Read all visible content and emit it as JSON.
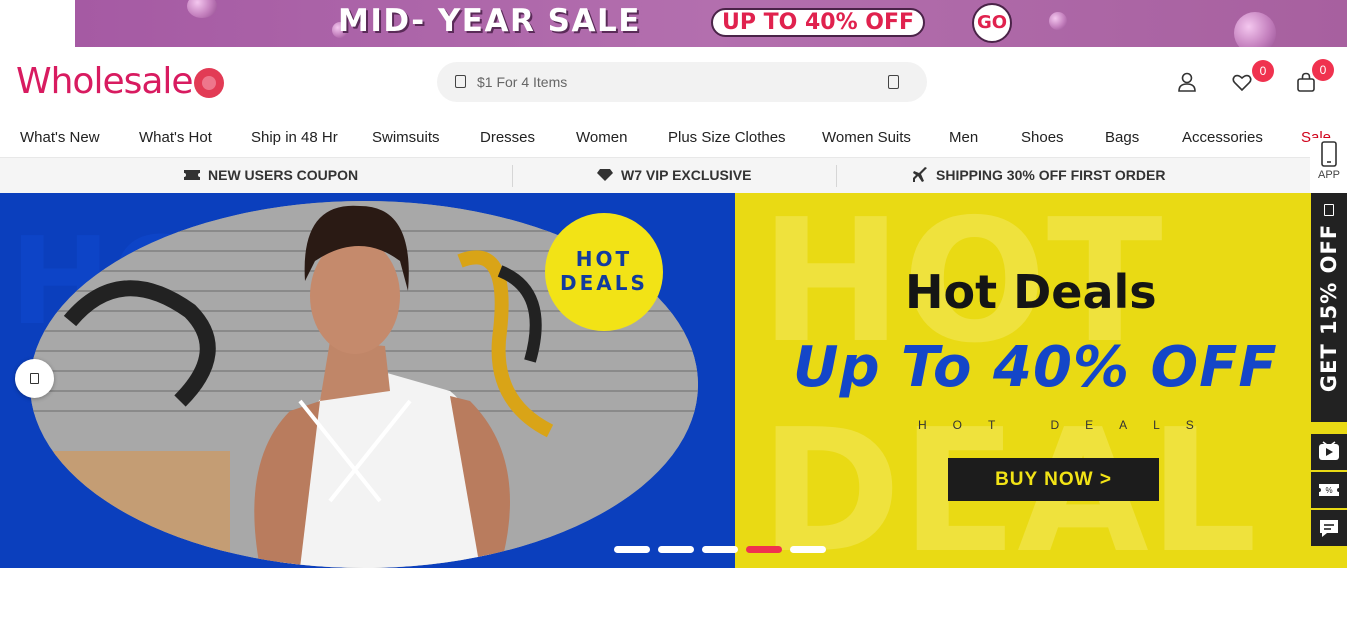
{
  "promo": {
    "title": "MID- YEAR SALE",
    "pill": "UP TO 40% OFF",
    "go": "GO"
  },
  "header": {
    "logo_text": "Wholesale",
    "search_placeholder": "$1 For 4 Items",
    "wishlist_count": "0",
    "cart_count": "0"
  },
  "nav": {
    "items": [
      "What's New",
      "What's Hot",
      "Ship in 48 Hr",
      "Swimsuits",
      "Dresses",
      "Women",
      "Plus Size Clothes",
      "Women Suits",
      "Men",
      "Shoes",
      "Bags",
      "Accessories",
      "Sale"
    ]
  },
  "benefits": {
    "coupon": "NEW USERS COUPON",
    "vip": "W7 VIP EXCLUSIVE",
    "shipping": "SHIPPING 30% OFF FIRST ORDER"
  },
  "hero": {
    "badge_line1": "HOT",
    "badge_line2": "DEALS",
    "title": "Hot Deals",
    "offer": "Up To 40% OFF",
    "subtitle": "HOT DEALS",
    "button": "BUY NOW >",
    "bg_word_left": "HOT",
    "bg_word_right_top": "HOT",
    "bg_word_right_bottom": "DEAL",
    "active_slide": 4,
    "slide_count": 5
  },
  "rail": {
    "app_label": "APP",
    "discount": "GET 15% OFF"
  },
  "colors": {
    "brand": "#d81b60",
    "badge": "#f0324f",
    "hero_blue": "#0b3fbd",
    "hero_yellow": "#e9da14",
    "promo_purple": "#a55aa3"
  }
}
